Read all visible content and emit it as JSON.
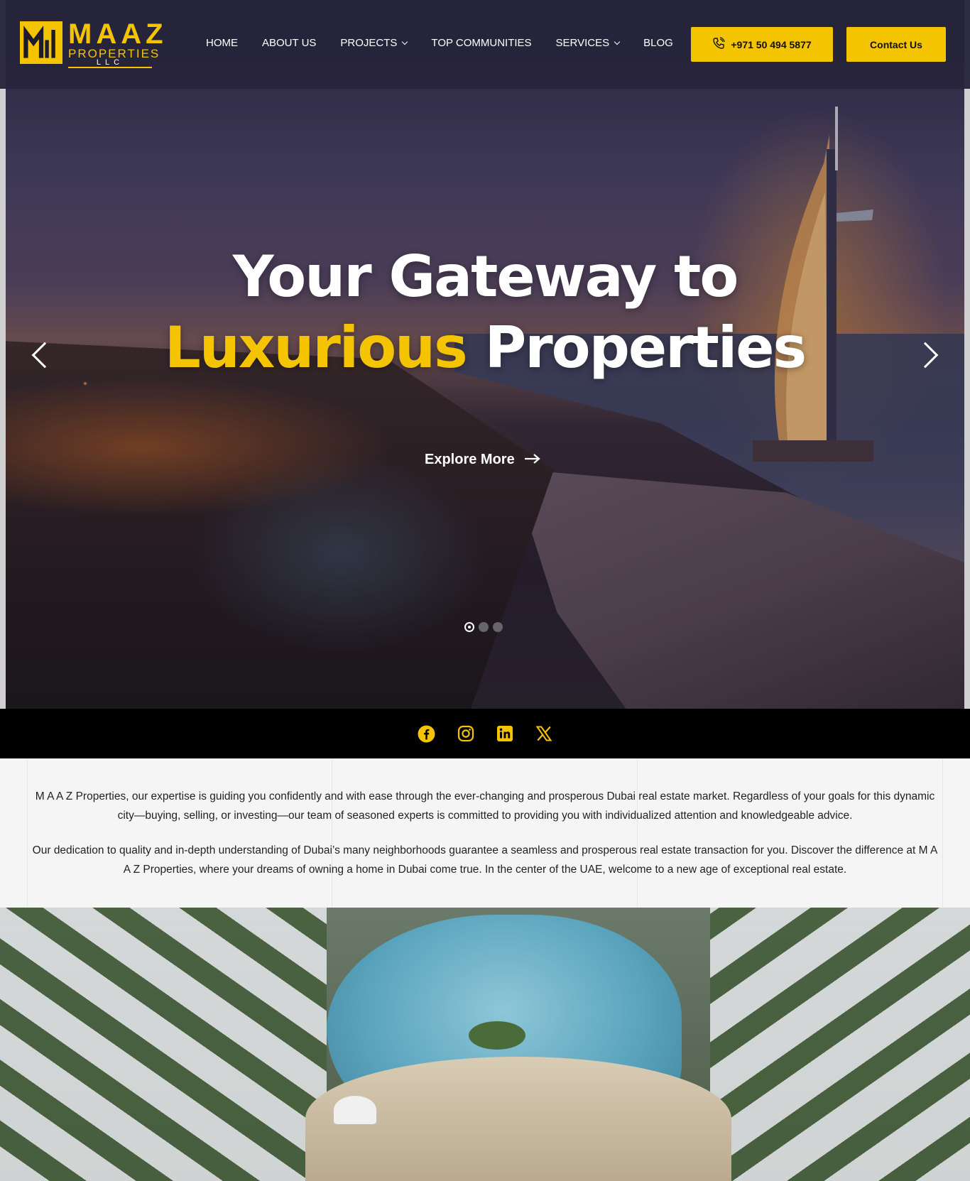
{
  "brand": {
    "name": "MAAZ",
    "sub": "PROPERTIES",
    "suffix": "LLC",
    "accent_color": "#f5c400",
    "header_bg": "#26243a"
  },
  "nav": {
    "items": [
      {
        "label": "HOME",
        "has_dropdown": false
      },
      {
        "label": "ABOUT US",
        "has_dropdown": false
      },
      {
        "label": "PROJECTS",
        "has_dropdown": true
      },
      {
        "label": "TOP COMMUNITIES",
        "has_dropdown": false
      },
      {
        "label": "SERVICES",
        "has_dropdown": true
      },
      {
        "label": "BLOG",
        "has_dropdown": false
      }
    ]
  },
  "header_buttons": {
    "phone_icon": "phone-icon",
    "phone_label": "+971 50 494 5877",
    "contact_label": "Contact Us"
  },
  "hero": {
    "line1": "Your Gateway to",
    "accent_word": "Luxurious",
    "line2_rest": "Properties",
    "cta_label": "Explore More",
    "cta_icon": "arrow-right-icon",
    "prev_icon": "chevron-left-icon",
    "next_icon": "chevron-right-icon",
    "slide_count": 3,
    "active_slide": 1
  },
  "social": {
    "icons": [
      "facebook-icon",
      "instagram-icon",
      "linkedin-icon",
      "x-icon"
    ]
  },
  "about": {
    "p1": "M A A Z Properties, our expertise is guiding you confidently and with ease through the ever-changing and prosperous Dubai real estate market. Regardless of your goals for this dynamic city—buying, selling, or investing—our team of seasoned experts is committed to providing you with individualized attention and knowledgeable advice.",
    "p2": "Our dedication to quality and in-depth understanding of Dubai’s many neighborhoods guarantee a seamless and prosperous real estate transaction for you. Discover the difference at M A A Z Properties, where your dreams of owning a home in Dubai come true. In the center of the UAE, welcome to a new age of exceptional real estate."
  }
}
